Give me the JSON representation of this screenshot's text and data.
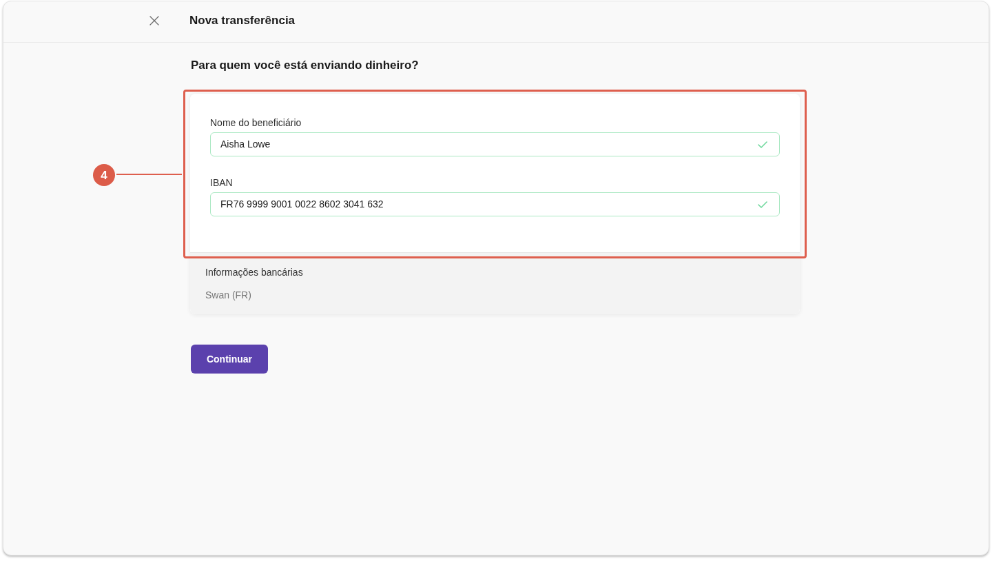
{
  "window": {
    "title": "Nova transferência"
  },
  "heading": "Para quem você está enviando dinheiro?",
  "form": {
    "fields": [
      {
        "label": "Nome do beneficiário",
        "value": "Aisha Lowe",
        "valid": true
      },
      {
        "label": "IBAN",
        "value": "FR76 9999 9001 0022 8602 3041 632",
        "valid": true
      }
    ]
  },
  "bank_info": {
    "title": "Informações bancárias",
    "value": "Swan (FR)"
  },
  "annotation": {
    "step": "4"
  },
  "buttons": [
    {
      "label": "Continuar"
    }
  ]
}
